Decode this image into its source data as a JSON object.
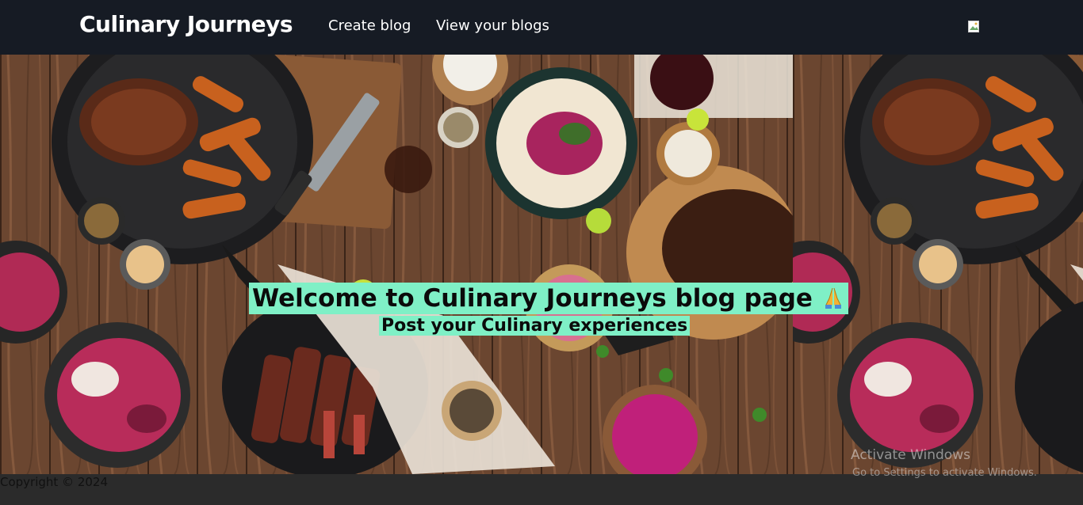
{
  "navbar": {
    "brand": "Culinary Journeys",
    "links": [
      "Create blog",
      "View your blogs"
    ],
    "background": "#161b24"
  },
  "hero": {
    "title": "Welcome to Culinary Journeys blog page",
    "title_emoji_icon": "folded-hands-icon",
    "subtitle": "Post your Culinary experiences",
    "highlight_color": "#7ff0c6",
    "background_image": "food-table-photo"
  },
  "footer": {
    "copyright": "Copyright © 2024"
  },
  "os_watermark": {
    "title": "Activate Windows",
    "subtitle": "Go to Settings to activate Windows."
  }
}
